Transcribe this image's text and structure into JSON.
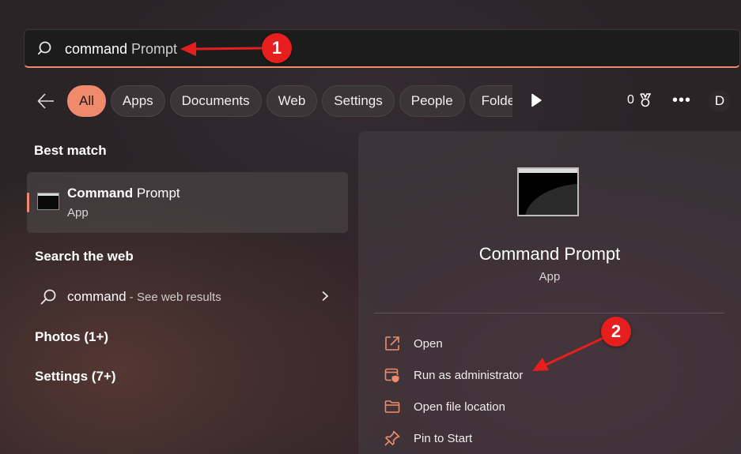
{
  "search": {
    "query_typed": "command",
    "query_suggest": " Prompt",
    "icon": "search-icon"
  },
  "filters": {
    "back_icon": "arrow-left-icon",
    "chips": [
      "All",
      "Apps",
      "Documents",
      "Web",
      "Settings",
      "People",
      "Folde"
    ],
    "active": "All",
    "play_icon": "play-icon",
    "points": "0",
    "points_icon": "medal-icon",
    "more_label": "•••",
    "avatar_letter": "D"
  },
  "left": {
    "best_match_title": "Best match",
    "best_match": {
      "name_bold": "Command",
      "name_rest": " Prompt",
      "type": "App",
      "icon": "command-prompt-icon"
    },
    "web_title": "Search the web",
    "web_row": {
      "query": "command",
      "hint": " - See web results",
      "icon": "search-icon",
      "chevron": "chevron-right-icon"
    },
    "photos_title": "Photos (1+)",
    "settings_title": "Settings (7+)"
  },
  "detail": {
    "name": "Command Prompt",
    "type": "App",
    "actions": [
      {
        "label": "Open",
        "icon": "open-external-icon"
      },
      {
        "label": "Run as administrator",
        "icon": "shield-window-icon"
      },
      {
        "label": "Open file location",
        "icon": "folder-icon"
      },
      {
        "label": "Pin to Start",
        "icon": "pin-icon"
      }
    ]
  },
  "annotations": {
    "step1": "1",
    "step2": "2"
  },
  "colors": {
    "accent": "#f08a6c",
    "annotation_red": "#e61e1e",
    "search_bg": "#1d1c1d"
  }
}
